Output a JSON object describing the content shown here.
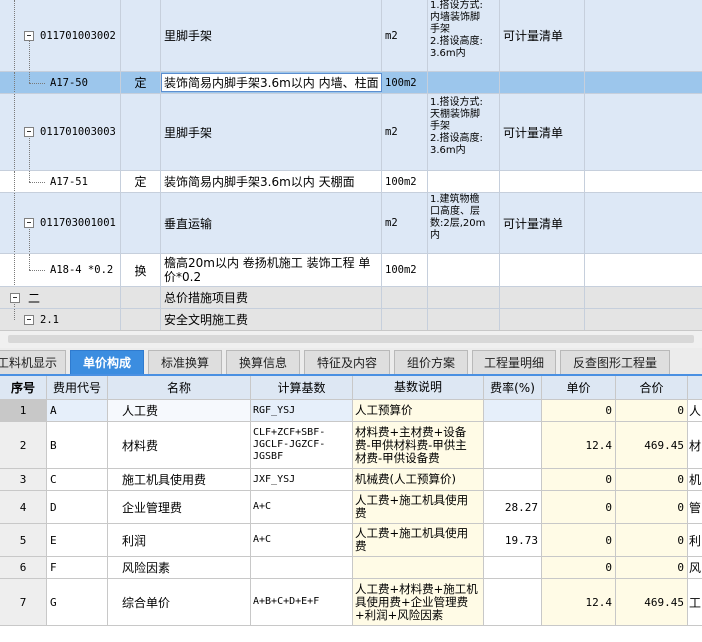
{
  "upper_rows": [
    {
      "code": "011701003002",
      "type": "",
      "name": "里脚手架",
      "unit": "m2",
      "feature_lines": [
        "1.搭设方式:",
        "内墙装饰脚",
        "手架",
        "2.搭设高度:",
        "3.6m内"
      ],
      "measure": "可计量清单"
    },
    {
      "code": "A17-50",
      "type": "定",
      "name": "装饰简易内脚手架3.6m以内 内墙、柱面",
      "unit": "100m2",
      "feature_lines": [],
      "measure": ""
    },
    {
      "code": "011701003003",
      "type": "",
      "name": "里脚手架",
      "unit": "m2",
      "feature_lines": [
        "1.搭设方式:",
        "天棚装饰脚",
        "手架",
        "2.搭设高度:",
        "3.6m内"
      ],
      "measure": "可计量清单"
    },
    {
      "code": "A17-51",
      "type": "定",
      "name": "装饰简易内脚手架3.6m以内 天棚面",
      "unit": "100m2",
      "feature_lines": [],
      "measure": ""
    },
    {
      "code": "011703001001",
      "type": "",
      "name": "垂直运输",
      "unit": "m2",
      "feature_lines": [
        "1.建筑物檐",
        "口高度、层",
        "数:2层,20m",
        "内"
      ],
      "measure": "可计量清单"
    },
    {
      "code": "A18-4 *0.2",
      "type": "换",
      "name_lines": [
        "檐高20m以内 卷扬机施工  装饰工程 单",
        "价*0.2"
      ],
      "unit": "100m2",
      "feature_lines": [],
      "measure": ""
    },
    {
      "code": "二",
      "type": "",
      "name": "总价措施项目费",
      "unit": "",
      "feature_lines": [],
      "measure": ""
    },
    {
      "code": "2.1",
      "type": "",
      "name": "安全文明施工费",
      "unit": "",
      "feature_lines": [],
      "measure": ""
    }
  ],
  "tabs": [
    "工料机显示",
    "单价构成",
    "标准换算",
    "换算信息",
    "特征及内容",
    "组价方案",
    "工程量明细",
    "反查图形工程量"
  ],
  "active_tab": "单价构成",
  "table_headers": [
    "序号",
    "费用代号",
    "名称",
    "计算基数",
    "基数说明",
    "费率(%)",
    "单价",
    "合价",
    ""
  ],
  "table_rows": [
    {
      "seq": "1",
      "code": "A",
      "name": "人工费",
      "base": [
        "RGF_YSJ"
      ],
      "desc": [
        "人工预算价"
      ],
      "rate": "",
      "price": "0",
      "total": "0",
      "extra": "人"
    },
    {
      "seq": "2",
      "code": "B",
      "name": "材料费",
      "base": [
        "CLF+ZCF+SBF-",
        "JGCLF-JGZCF-",
        "JGSBF"
      ],
      "desc": [
        "材料费+主材费+设备",
        "费-甲供材料费-甲供主",
        "材费-甲供设备费"
      ],
      "rate": "",
      "price": "12.4",
      "total": "469.45",
      "extra": "材"
    },
    {
      "seq": "3",
      "code": "C",
      "name": "施工机具使用费",
      "base": [
        "JXF_YSJ"
      ],
      "desc": [
        "机械费(人工预算价)"
      ],
      "rate": "",
      "price": "0",
      "total": "0",
      "extra": "机"
    },
    {
      "seq": "4",
      "code": "D",
      "name": "企业管理费",
      "base": [
        "A+C"
      ],
      "desc": [
        "人工费+施工机具使用",
        "费"
      ],
      "rate": "28.27",
      "price": "0",
      "total": "0",
      "extra": "管"
    },
    {
      "seq": "5",
      "code": "E",
      "name": "利润",
      "base": [
        "A+C"
      ],
      "desc": [
        "人工费+施工机具使用",
        "费"
      ],
      "rate": "19.73",
      "price": "0",
      "total": "0",
      "extra": "利"
    },
    {
      "seq": "6",
      "code": "F",
      "name": "风险因素",
      "base": [],
      "desc": [],
      "rate": "",
      "price": "0",
      "total": "0",
      "extra": "风"
    },
    {
      "seq": "7",
      "code": "G",
      "name": "综合单价",
      "base": [
        "A+B+C+D+E+F"
      ],
      "desc": [
        "人工费+材料费+施工机",
        "具使用费+企业管理费",
        "+利润+风险因素"
      ],
      "rate": "",
      "price": "12.4",
      "total": "469.45",
      "extra": "工"
    }
  ]
}
